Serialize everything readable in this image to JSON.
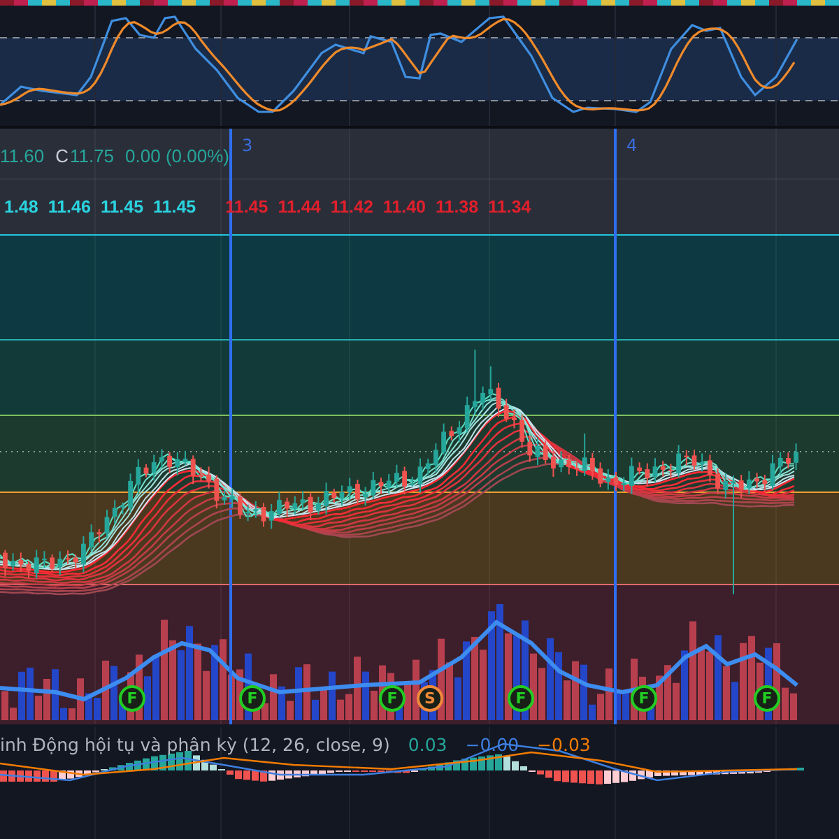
{
  "price_legend": {
    "values": [
      {
        "text": "11.60",
        "kind": "value"
      },
      {
        "text": "C",
        "kind": "label"
      },
      {
        "text": "11.75",
        "kind": "value"
      },
      {
        "text": "0.00 (0.00%)",
        "kind": "value"
      }
    ]
  },
  "ribbon_legend": {
    "values": [
      {
        "text": "1.48",
        "color": "#2ad4e0"
      },
      {
        "text": "11.46",
        "color": "#2ad4e0"
      },
      {
        "text": "11.45",
        "color": "#2ad4e0"
      },
      {
        "text": "11.45",
        "color": "#2ad4e0"
      },
      {
        "text": "11.45",
        "color": "#e0202c"
      },
      {
        "text": "11.44",
        "color": "#e0202c"
      },
      {
        "text": "11.42",
        "color": "#e0202c"
      },
      {
        "text": "11.40",
        "color": "#e0202c"
      },
      {
        "text": "11.38",
        "color": "#e0202c"
      },
      {
        "text": "11.34",
        "color": "#e0202c"
      }
    ]
  },
  "session_markers": [
    {
      "label": "3"
    },
    {
      "label": "4"
    }
  ],
  "signals": [
    {
      "label": "F",
      "color": "#22cc22"
    },
    {
      "label": "F",
      "color": "#22cc22"
    },
    {
      "label": "F",
      "color": "#22cc22"
    },
    {
      "label": "S",
      "color": "#f08a3a"
    },
    {
      "label": "F",
      "color": "#22cc22"
    },
    {
      "label": "F",
      "color": "#22cc22"
    },
    {
      "label": "F",
      "color": "#22cc22"
    }
  ],
  "macd_legend": {
    "title": "inh Động hội tụ và phân kỳ (12, 26, close, 9)",
    "values": [
      {
        "text": "0.03",
        "color": "#26a69a"
      },
      {
        "text": "−0.00",
        "color": "#3d7fe0"
      },
      {
        "text": "−0.03",
        "color": "#f57c00"
      }
    ]
  }
}
